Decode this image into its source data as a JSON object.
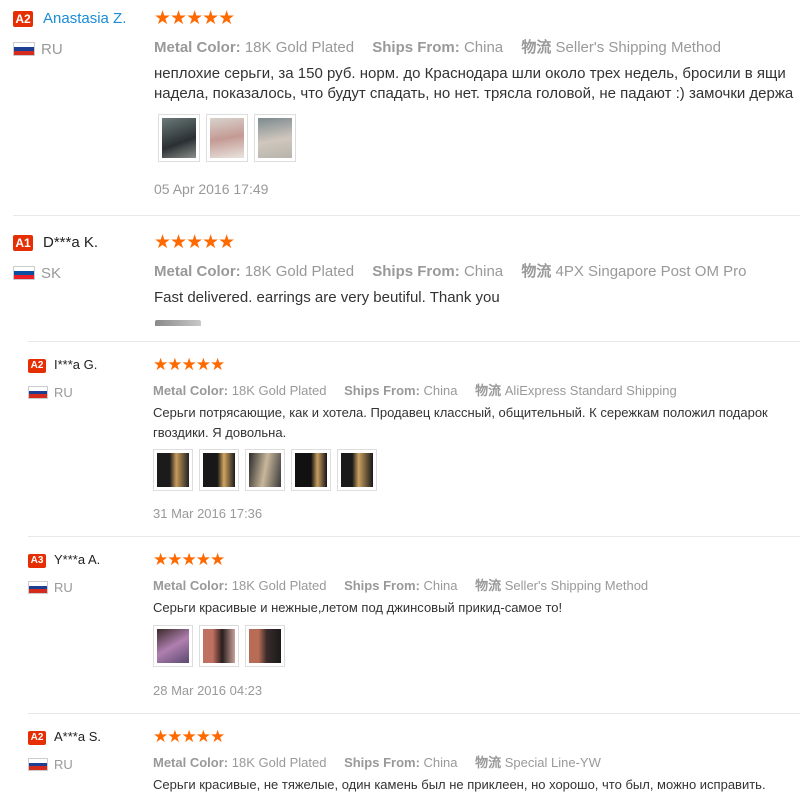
{
  "labels": {
    "metal_color": "Metal Color:",
    "ships_from": "Ships From:",
    "logistics": "物流"
  },
  "stars": "★★★★★",
  "flags": {
    "RU": [
      "#ffffff",
      "#1c3f94",
      "#d52b1e"
    ],
    "SK": [
      "#ffffff",
      "#0b4ea2",
      "#ee1c25"
    ]
  },
  "reviews": [
    {
      "badge": "A2",
      "name": "Anastasia Z.",
      "country": "RU",
      "metal_color": "18K Gold Plated",
      "ships_from": "China",
      "shipping": "Seller's Shipping Method",
      "text": [
        "неплохие серьги, за 150 руб. норм. до Краснодара шли около трех недель, бросили в ящи",
        "надела, показалось, что будут спадать, но нет. трясла головой, не падают :) замочки держа"
      ],
      "date": "05 Apr 2016 17:49"
    },
    {
      "badge": "A1",
      "name": "D***a K.",
      "country": "SK",
      "metal_color": "18K Gold Plated",
      "ships_from": "China",
      "shipping": "4PX Singapore Post OM Pro",
      "text": [
        "Fast delivered. earrings are very beutiful. Thank you"
      ],
      "date": ""
    },
    {
      "badge": "A2",
      "name": "I***a G.",
      "country": "RU",
      "metal_color": "18K Gold Plated",
      "ships_from": "China",
      "shipping": "AliExpress Standard Shipping",
      "text": [
        "Серьги потрясающие, как и хотела. Продавец классный, общительный. К сережкам положил подарок",
        "гвоздики. Я довольна."
      ],
      "date": "31 Mar 2016 17:36"
    },
    {
      "badge": "A3",
      "name": "Y***a A.",
      "country": "RU",
      "metal_color": "18K Gold Plated",
      "ships_from": "China",
      "shipping": "Seller's Shipping Method",
      "text": [
        "Серьги красивые и нежные,летом под джинсовый прикид-самое то!"
      ],
      "date": "28 Mar 2016 04:23"
    },
    {
      "badge": "A2",
      "name": "A***a S.",
      "country": "RU",
      "metal_color": "18K Gold Plated",
      "ships_from": "China",
      "shipping": "Special Line-YW",
      "text": [
        "Серьги красивые, не тяжелые, один камень был не приклеен, но хорошо, что был, можно исправить."
      ],
      "date": ""
    }
  ]
}
